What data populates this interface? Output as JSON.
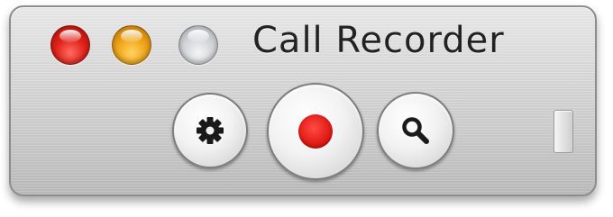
{
  "window": {
    "title": "Call Recorder"
  },
  "traffic_lights": [
    {
      "name": "close",
      "color": "#e2221a"
    },
    {
      "name": "minimize",
      "color": "#f0a51a"
    },
    {
      "name": "zoom",
      "color": "#cfd3d6"
    }
  ],
  "toolbar": {
    "buttons": [
      {
        "icon": "gear-icon"
      },
      {
        "icon": "record-icon",
        "color": "#e01914"
      },
      {
        "icon": "search-icon"
      }
    ]
  },
  "colors": {
    "record_accent": "#e01914",
    "window_chrome": "#d6d6d6"
  }
}
